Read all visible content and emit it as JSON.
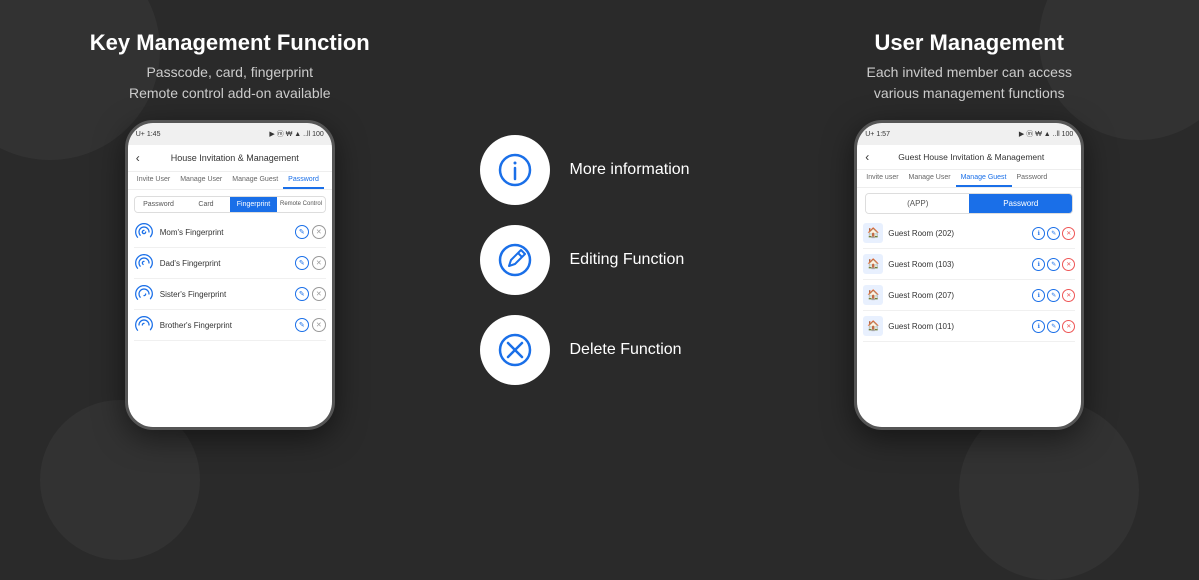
{
  "left": {
    "title": "Key Management Function",
    "subtitle_line1": "Passcode, card, fingerprint",
    "subtitle_line2": "Remote control add-on available",
    "phone": {
      "status_left": "U+  1:45",
      "status_right": "▶ ⓜ ₩ ▲ ..ll 100",
      "nav_title": "House Invitation & Management",
      "tabs": [
        "Invite User",
        "Manage User",
        "Manage Guest",
        "Password"
      ],
      "active_tab": "Password",
      "sub_tabs": [
        "Password",
        "Card",
        "Fingerprint",
        "Remote Control"
      ],
      "active_sub_tab": "Fingerprint",
      "items": [
        "Mom's Fingerprint",
        "Dad's Fingerprint",
        "Sister's Fingerprint",
        "Brother's Fingerprint"
      ]
    }
  },
  "middle": {
    "functions": [
      {
        "label": "More information",
        "icon": "info"
      },
      {
        "label": "Editing Function",
        "icon": "edit"
      },
      {
        "label": "Delete Function",
        "icon": "delete"
      }
    ]
  },
  "right": {
    "title": "User Management",
    "subtitle_line1": "Each invited member can access",
    "subtitle_line2": "various management functions",
    "phone": {
      "status_left": "U+  1:57",
      "status_right": "▶ ⓜ ₩ ▲ ..ll 100",
      "nav_title": "Guest House Invitation & Management",
      "tabs": [
        "Invite user",
        "Manage User",
        "Manage Guest",
        "Password"
      ],
      "active_tab": "Manage Guest",
      "sub_tabs": [
        "(APP)",
        "Password"
      ],
      "active_sub_tab": "Password",
      "items": [
        "Guest Room (202)",
        "Guest Room (103)",
        "Guest Room (207)",
        "Guest Room (101)"
      ]
    }
  }
}
